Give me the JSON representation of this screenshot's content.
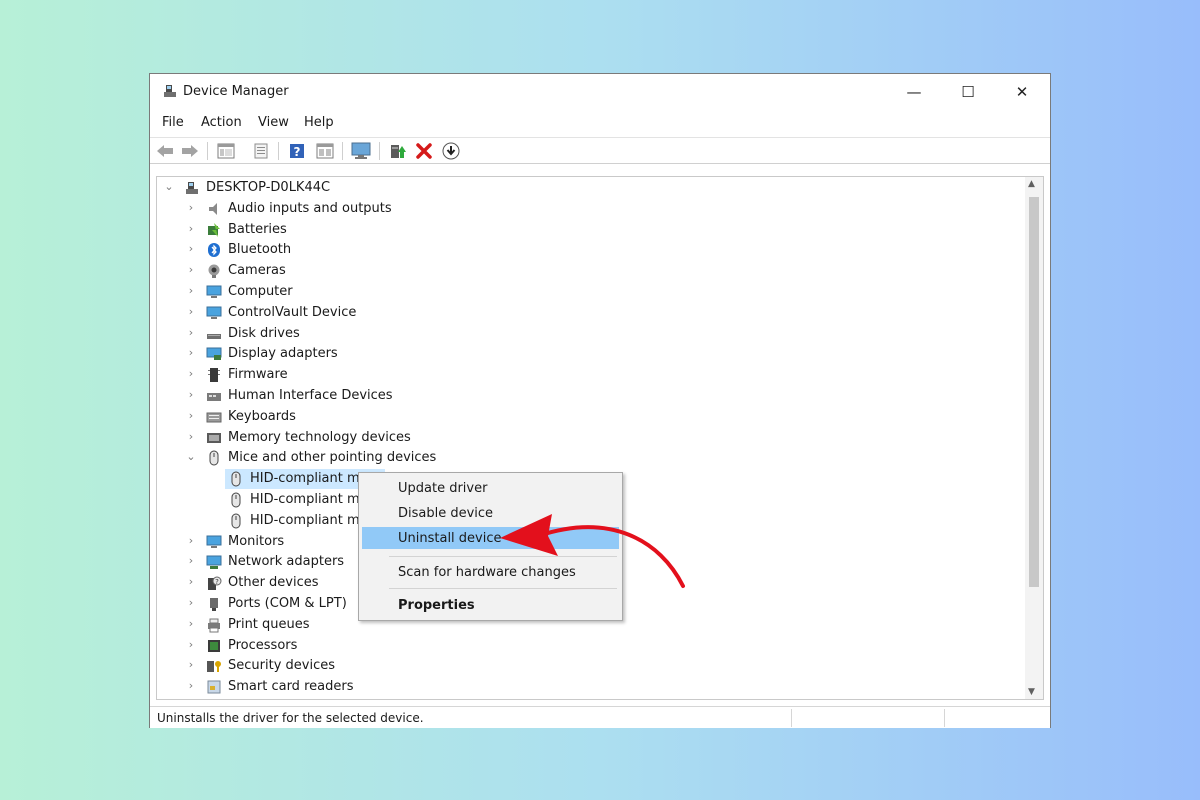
{
  "window": {
    "title": "Device Manager",
    "controls": {
      "minimize": "—",
      "maximize": "☐",
      "close": "✕"
    }
  },
  "menu": [
    "File",
    "Action",
    "View",
    "Help"
  ],
  "toolbar_icons": [
    "back-arrow-icon",
    "forward-arrow-icon",
    "properties-list-icon",
    "update-doc-icon",
    "help-icon",
    "view-grid-icon",
    "monitor-scan-icon",
    "add-driver-icon",
    "uninstall-x-icon",
    "download-update-icon"
  ],
  "tree": {
    "root": "DESKTOP-D0LK44C",
    "categories": [
      {
        "label": "Audio inputs and outputs",
        "icon": "speaker-icon",
        "expanded": false
      },
      {
        "label": "Batteries",
        "icon": "battery-icon",
        "expanded": false
      },
      {
        "label": "Bluetooth",
        "icon": "bluetooth-icon",
        "expanded": false
      },
      {
        "label": "Cameras",
        "icon": "camera-icon",
        "expanded": false
      },
      {
        "label": "Computer",
        "icon": "computer-icon",
        "expanded": false
      },
      {
        "label": "ControlVault Device",
        "icon": "controlvault-icon",
        "expanded": false
      },
      {
        "label": "Disk drives",
        "icon": "disk-drive-icon",
        "expanded": false
      },
      {
        "label": "Display adapters",
        "icon": "display-adapter-icon",
        "expanded": false
      },
      {
        "label": "Firmware",
        "icon": "firmware-icon",
        "expanded": false
      },
      {
        "label": "Human Interface Devices",
        "icon": "hid-icon",
        "expanded": false
      },
      {
        "label": "Keyboards",
        "icon": "keyboard-icon",
        "expanded": false
      },
      {
        "label": "Memory technology devices",
        "icon": "memory-icon",
        "expanded": false
      },
      {
        "label": "Mice and other pointing devices",
        "icon": "mouse-icon",
        "expanded": true
      },
      {
        "label": "Monitors",
        "icon": "monitor-icon",
        "expanded": false
      },
      {
        "label": "Network adapters",
        "icon": "network-icon",
        "expanded": false
      },
      {
        "label": "Other devices",
        "icon": "unknown-device-icon",
        "expanded": false
      },
      {
        "label": "Ports (COM & LPT)",
        "icon": "port-icon",
        "expanded": false
      },
      {
        "label": "Print queues",
        "icon": "printer-icon",
        "expanded": false
      },
      {
        "label": "Processors",
        "icon": "processor-icon",
        "expanded": false
      },
      {
        "label": "Security devices",
        "icon": "security-key-icon",
        "expanded": false
      },
      {
        "label": "Smart card readers",
        "icon": "smart-card-icon",
        "expanded": false
      }
    ],
    "mice_children": [
      "HID-compliant mo",
      "HID-compliant mo",
      "HID-compliant mo"
    ]
  },
  "context_menu": {
    "items": [
      "Update driver",
      "Disable device",
      "Uninstall device",
      "Scan for hardware changes",
      "Properties"
    ],
    "highlighted": "Uninstall device",
    "bold": "Properties"
  },
  "status": {
    "text": "Uninstalls the driver for the selected device."
  },
  "colors": {
    "highlight": "#91c9f7",
    "selection": "#cce8ff",
    "arrow": "#e3101c"
  }
}
